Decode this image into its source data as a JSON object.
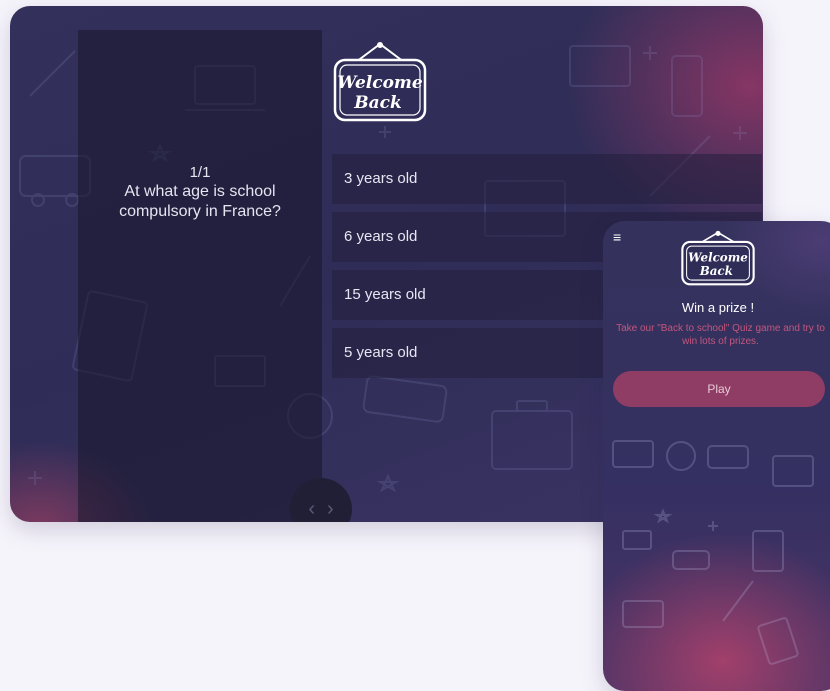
{
  "tablet": {
    "logo": {
      "line1": "Welcome",
      "line2": "Back"
    },
    "question": {
      "counter": "1/1",
      "text": "At what age is school compulsory in France?"
    },
    "answers": [
      {
        "label": "3 years old"
      },
      {
        "label": "6 years old"
      },
      {
        "label": "15 years old"
      },
      {
        "label": "5 years old"
      }
    ],
    "nav": {
      "prev_icon": "chevron-left-icon",
      "next_icon": "chevron-right-icon"
    }
  },
  "phone": {
    "menu_icon": "hamburger-icon",
    "logo": {
      "line1": "Welcome",
      "line2": "Back"
    },
    "title": "Win a prize !",
    "description": "Take our \"Back to school\" Quiz game and try to win lots of prizes.",
    "play_label": "Play"
  },
  "colors": {
    "background": "#33315b",
    "panel": "#18162a",
    "play_button": "#8f3d64",
    "accent_pink": "#c2577e"
  }
}
